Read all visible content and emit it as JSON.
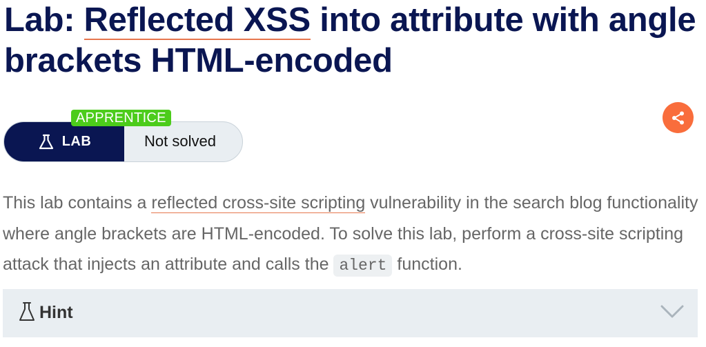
{
  "title": {
    "prefix": "Lab: ",
    "link_text": "Reflected XSS",
    "suffix": " into attribute with angle brackets HTML-encoded"
  },
  "badge": {
    "level": "APPRENTICE",
    "type_label": "LAB",
    "status": "Not solved"
  },
  "description": {
    "part1": "This lab contains a ",
    "link_text": "reflected cross-site scripting",
    "part2": " vulnerability in the search blog functionality where angle brackets are HTML-encoded. To solve this lab, perform a cross-site scripting attack that injects an attribute and calls the ",
    "code": "alert",
    "part3": " function."
  },
  "hint": {
    "label": "Hint"
  },
  "icons": {
    "flask": "flask-icon",
    "share": "share-icon",
    "chevron": "chevron-down-icon"
  },
  "colors": {
    "navy": "#0a1652",
    "accent_orange": "#f96d3c",
    "apprentice_green": "#4ccc1b",
    "panel_gray": "#e9eef2"
  }
}
